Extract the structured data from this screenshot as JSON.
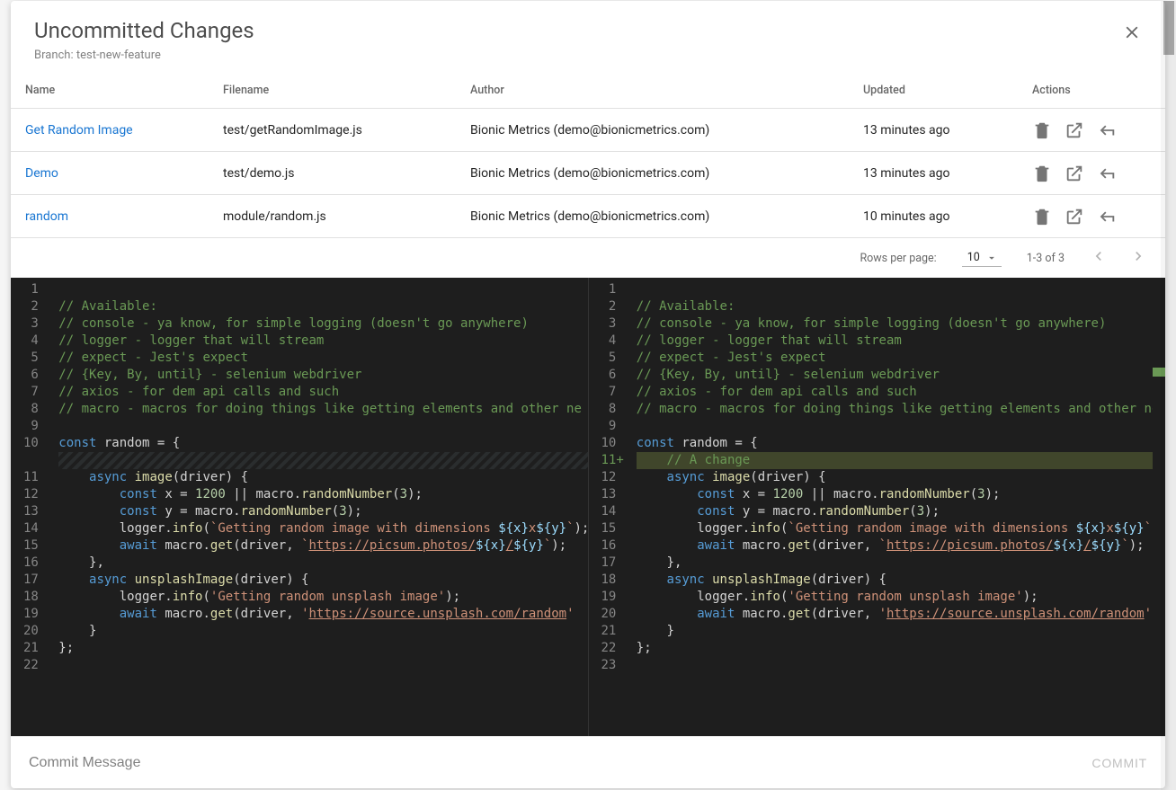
{
  "header": {
    "title": "Uncommitted Changes",
    "branch_label": "Branch: test-new-feature"
  },
  "table": {
    "columns": {
      "name": "Name",
      "filename": "Filename",
      "author": "Author",
      "updated": "Updated",
      "actions": "Actions"
    },
    "rows": [
      {
        "name": "Get Random Image",
        "filename": "test/getRandomImage.js",
        "author": "Bionic Metrics (demo@bionicmetrics.com)",
        "updated": "13 minutes ago"
      },
      {
        "name": "Demo",
        "filename": "test/demo.js",
        "author": "Bionic Metrics (demo@bionicmetrics.com)",
        "updated": "13 minutes ago"
      },
      {
        "name": "random",
        "filename": "module/random.js",
        "author": "Bionic Metrics (demo@bionicmetrics.com)",
        "updated": "10 minutes ago"
      }
    ]
  },
  "pagination": {
    "rows_per_page_label": "Rows per page:",
    "rows_per_page_value": "10",
    "range_label": "1-3 of 3"
  },
  "diff": {
    "left": {
      "lines": [
        {
          "n": 1,
          "t": ""
        },
        {
          "n": 2,
          "t": "// Available:",
          "cls": "comment"
        },
        {
          "n": 3,
          "t": "// console - ya know, for simple logging (doesn't go anywhere)",
          "cls": "comment"
        },
        {
          "n": 4,
          "t": "// logger - logger that will stream",
          "cls": "comment"
        },
        {
          "n": 5,
          "t": "// expect - Jest's expect",
          "cls": "comment"
        },
        {
          "n": 6,
          "t": "// {Key, By, until} - selenium webdriver",
          "cls": "comment"
        },
        {
          "n": 7,
          "t": "// axios - for dem api calls and such",
          "cls": "comment"
        },
        {
          "n": 8,
          "t": "// macro - macros for doing things like getting elements and other ne",
          "cls": "comment"
        },
        {
          "n": 9,
          "t": ""
        },
        {
          "n": 10,
          "html": "<span class='tok-kw'>const</span> random = {"
        },
        {
          "spacer": true
        },
        {
          "n": 11,
          "html": "    <span class='tok-kw'>async</span> <span class='tok-fn'>image</span>(driver) {"
        },
        {
          "n": 12,
          "html": "        <span class='tok-kw'>const</span> x = <span class='tok-num'>1200</span> || macro.<span class='tok-fn'>randomNumber</span>(<span class='tok-num'>3</span>);"
        },
        {
          "n": 13,
          "html": "        <span class='tok-kw'>const</span> y = macro.<span class='tok-fn'>randomNumber</span>(<span class='tok-num'>3</span>);"
        },
        {
          "n": 14,
          "html": "        logger.<span class='tok-fn'>info</span>(<span class='tok-str'>`Getting random image with dimensions </span><span class='tok-tmpl'>${x}</span><span class='tok-str'>x</span><span class='tok-tmpl'>${y}</span><span class='tok-str'>`</span>);"
        },
        {
          "n": 15,
          "html": "        <span class='tok-kw'>await</span> macro.<span class='tok-fn'>get</span>(driver, <span class='tok-str'>`</span><span class='tok-link'>https://picsum.photos/</span><span class='tok-tmpl'>${x}</span><span class='tok-link'>/</span><span class='tok-tmpl'>${y}</span><span class='tok-str'>`</span>);"
        },
        {
          "n": 16,
          "t": "    },"
        },
        {
          "n": 17,
          "html": "    <span class='tok-kw'>async</span> <span class='tok-fn'>unsplashImage</span>(driver) {"
        },
        {
          "n": 18,
          "html": "        logger.<span class='tok-fn'>info</span>(<span class='tok-str'>'Getting random unsplash image'</span>);"
        },
        {
          "n": 19,
          "html": "        <span class='tok-kw'>await</span> macro.<span class='tok-fn'>get</span>(driver, <span class='tok-str'>'</span><span class='tok-link'>https://source.unsplash.com/random</span><span class='tok-str'>'</span>"
        },
        {
          "n": 20,
          "t": "    }"
        },
        {
          "n": 21,
          "t": "};"
        },
        {
          "n": 22,
          "t": ""
        }
      ]
    },
    "right": {
      "lines": [
        {
          "n": 1,
          "t": ""
        },
        {
          "n": 2,
          "t": "// Available:",
          "cls": "comment"
        },
        {
          "n": 3,
          "t": "// console - ya know, for simple logging (doesn't go anywhere)",
          "cls": "comment"
        },
        {
          "n": 4,
          "t": "// logger - logger that will stream",
          "cls": "comment"
        },
        {
          "n": 5,
          "t": "// expect - Jest's expect",
          "cls": "comment"
        },
        {
          "n": 6,
          "t": "// {Key, By, until} - selenium webdriver",
          "cls": "comment"
        },
        {
          "n": 7,
          "t": "// axios - for dem api calls and such",
          "cls": "comment"
        },
        {
          "n": 8,
          "t": "// macro - macros for doing things like getting elements and other ne",
          "cls": "comment"
        },
        {
          "n": 9,
          "t": ""
        },
        {
          "n": 10,
          "html": "<span class='tok-kw'>const</span> random = {"
        },
        {
          "n": 11,
          "added": true,
          "html": "    <span class='tok-comment'>// A change</span>"
        },
        {
          "n": 12,
          "html": "    <span class='tok-kw'>async</span> <span class='tok-fn'>image</span>(driver) {"
        },
        {
          "n": 13,
          "html": "        <span class='tok-kw'>const</span> x = <span class='tok-num'>1200</span> || macro.<span class='tok-fn'>randomNumber</span>(<span class='tok-num'>3</span>);"
        },
        {
          "n": 14,
          "html": "        <span class='tok-kw'>const</span> y = macro.<span class='tok-fn'>randomNumber</span>(<span class='tok-num'>3</span>);"
        },
        {
          "n": 15,
          "html": "        logger.<span class='tok-fn'>info</span>(<span class='tok-str'>`Getting random image with dimensions </span><span class='tok-tmpl'>${x}</span><span class='tok-str'>x</span><span class='tok-tmpl'>${y}</span><span class='tok-str'>`</span>);"
        },
        {
          "n": 16,
          "html": "        <span class='tok-kw'>await</span> macro.<span class='tok-fn'>get</span>(driver, <span class='tok-str'>`</span><span class='tok-link'>https://picsum.photos/</span><span class='tok-tmpl'>${x}</span><span class='tok-link'>/</span><span class='tok-tmpl'>${y}</span><span class='tok-str'>`</span>);"
        },
        {
          "n": 17,
          "t": "    },"
        },
        {
          "n": 18,
          "html": "    <span class='tok-kw'>async</span> <span class='tok-fn'>unsplashImage</span>(driver) {"
        },
        {
          "n": 19,
          "html": "        logger.<span class='tok-fn'>info</span>(<span class='tok-str'>'Getting random unsplash image'</span>);"
        },
        {
          "n": 20,
          "html": "        <span class='tok-kw'>await</span> macro.<span class='tok-fn'>get</span>(driver, <span class='tok-str'>'</span><span class='tok-link'>https://source.unsplash.com/random</span><span class='tok-str'>'</span>)"
        },
        {
          "n": 21,
          "t": "    }"
        },
        {
          "n": 22,
          "t": "};"
        },
        {
          "n": 23,
          "t": ""
        }
      ]
    }
  },
  "footer": {
    "commit_placeholder": "Commit Message",
    "commit_button": "COMMIT"
  }
}
